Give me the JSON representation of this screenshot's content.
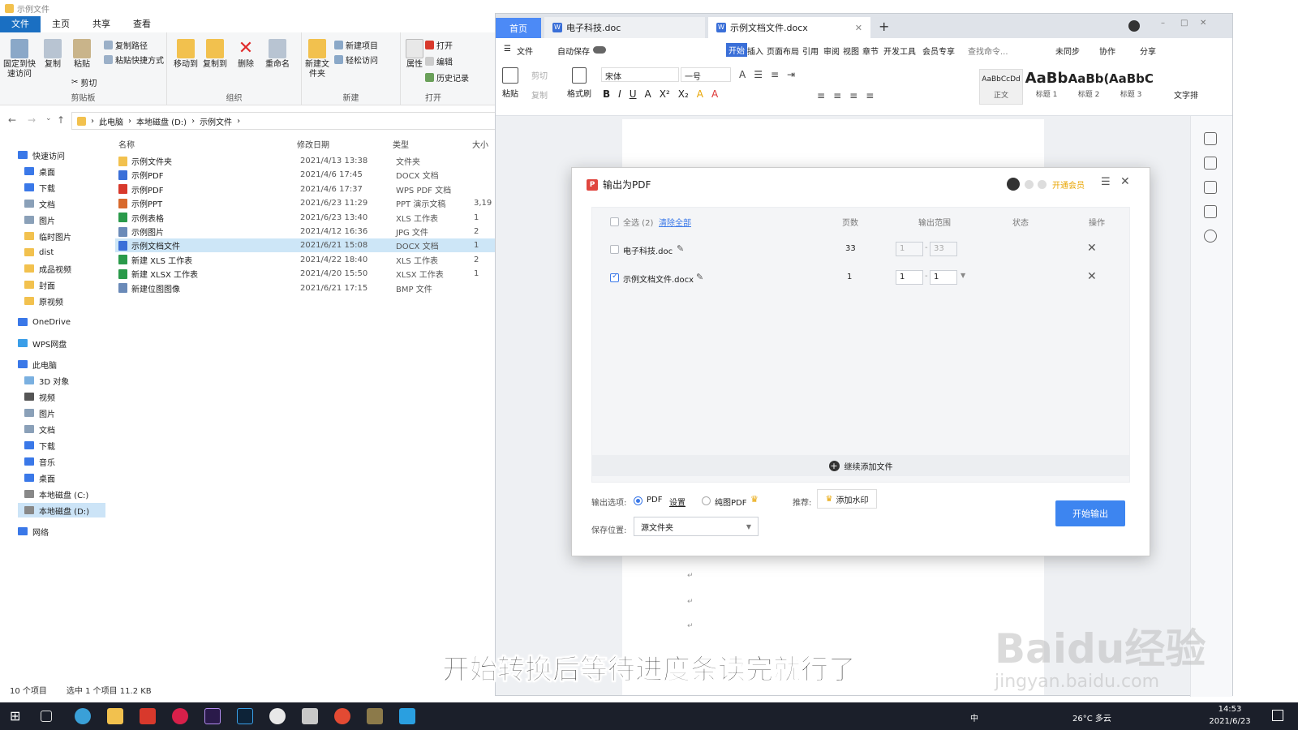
{
  "explorer": {
    "title": "示例文件",
    "tabs": [
      "文件",
      "主页",
      "共享",
      "查看"
    ],
    "ribbon": {
      "pin": "固定到快速访问",
      "copy": "复制",
      "paste": "粘贴",
      "copy_path": "复制路径",
      "paste_shortcut": "粘贴快捷方式",
      "cut": "剪切",
      "clipboard": "剪贴板",
      "move_to": "移动到",
      "copy_to": "复制到",
      "delete": "删除",
      "rename": "重命名",
      "organize": "组织",
      "new_folder": "新建文件夹",
      "new_item": "新建项目",
      "easy_access": "轻松访问",
      "new": "新建",
      "properties": "属性",
      "open": "打开",
      "edit": "编辑",
      "history": "历史记录",
      "open_group": "打开"
    },
    "breadcrumb": [
      "此电脑",
      "本地磁盘 (D:)",
      "示例文件"
    ],
    "nav": {
      "quick_access": "快速访问",
      "qa_items": [
        "桌面",
        "下载",
        "文档",
        "图片",
        "临时图片",
        "dist",
        "成品视频",
        "封面",
        "原视频"
      ],
      "onedrive": "OneDrive",
      "wps": "WPS网盘",
      "this_pc": "此电脑",
      "pc_items": [
        "3D 对象",
        "视频",
        "图片",
        "文档",
        "下载",
        "音乐",
        "桌面",
        "本地磁盘 (C:)",
        "本地磁盘 (D:)"
      ],
      "network": "网络"
    },
    "columns": [
      "名称",
      "修改日期",
      "类型",
      "大小"
    ],
    "files": [
      {
        "name": "示例文件夹",
        "date": "2021/4/13 13:38",
        "type": "文件夹",
        "size": ""
      },
      {
        "name": "示例PDF",
        "date": "2021/4/6 17:45",
        "type": "DOCX 文档",
        "size": ""
      },
      {
        "name": "示例PDF",
        "date": "2021/4/6 17:37",
        "type": "WPS PDF 文档",
        "size": ""
      },
      {
        "name": "示例PPT",
        "date": "2021/6/23 11:29",
        "type": "PPT 演示文稿",
        "size": "3,19"
      },
      {
        "name": "示例表格",
        "date": "2021/6/23 13:40",
        "type": "XLS 工作表",
        "size": "1"
      },
      {
        "name": "示例图片",
        "date": "2021/4/12 16:36",
        "type": "JPG 文件",
        "size": "2"
      },
      {
        "name": "示例文档文件",
        "date": "2021/6/21 15:08",
        "type": "DOCX 文档",
        "size": "1"
      },
      {
        "name": "新建 XLS 工作表",
        "date": "2021/4/22 18:40",
        "type": "XLS 工作表",
        "size": "2"
      },
      {
        "name": "新建 XLSX 工作表",
        "date": "2021/4/20 15:50",
        "type": "XLSX 工作表",
        "size": "1"
      },
      {
        "name": "新建位图图像",
        "date": "2021/6/21 17:15",
        "type": "BMP 文件",
        "size": ""
      }
    ],
    "status": {
      "count": "10 个项目",
      "selected": "选中 1 个项目  11.2 KB"
    }
  },
  "wps": {
    "tabs": {
      "home": "首页",
      "doc1": "电子科技.doc",
      "doc2": "示例文档文件.docx"
    },
    "menu": [
      "文件",
      "自动保存",
      "开始",
      "插入",
      "页面布局",
      "引用",
      "审阅",
      "视图",
      "章节",
      "开发工具",
      "会员专享",
      "查找命令...",
      "未同步",
      "协作",
      "分享"
    ],
    "toolbar": {
      "paste": "粘贴",
      "cut": "剪切",
      "copy": "复制",
      "format_painter": "格式刷",
      "font": "宋体",
      "size": "一号",
      "text_layout": "文字排"
    },
    "styles": [
      {
        "preview": "AaBbCcDd",
        "label": "正文"
      },
      {
        "preview": "AaBb",
        "label": "标题 1"
      },
      {
        "preview": "AaBb(",
        "label": "标题 2"
      },
      {
        "preview": "AaBbC",
        "label": "标题 3"
      }
    ]
  },
  "dialog": {
    "title": "输出为PDF",
    "vip": "开通会员",
    "select_all": "全选 (2)",
    "clear_all": "清除全部",
    "headers": {
      "pages": "页数",
      "range": "输出范围",
      "state": "状态",
      "op": "操作"
    },
    "rows": [
      {
        "name": "电子科技.doc",
        "pages": "33",
        "from": "1",
        "to": "33",
        "checked": false
      },
      {
        "name": "示例文档文件.docx",
        "pages": "1",
        "from": "1",
        "to": "1",
        "checked": true
      }
    ],
    "add_more": "继续添加文件",
    "output_label": "输出选项:",
    "opt_pdf": "PDF",
    "settings": "设置",
    "opt_image_pdf": "纯图PDF",
    "recommend": "推荐:",
    "watermark": "添加水印",
    "save_label": "保存位置:",
    "save_value": "源文件夹",
    "start": "开始输出"
  },
  "subtitle": "开始转换后等待进度条读完就行了",
  "watermark": {
    "main": "Baidu经验",
    "url": "jingyan.baidu.com"
  },
  "taskbar": {
    "ime": "中",
    "weather": "26°C 多云",
    "time": "14:53",
    "date": "2021/6/23"
  },
  "colors": {
    "accent": "#3d85f0",
    "file_tab": "#1a6fc2",
    "taskbar": "#1b1f2a",
    "pdf_icon": "#e0463f"
  }
}
